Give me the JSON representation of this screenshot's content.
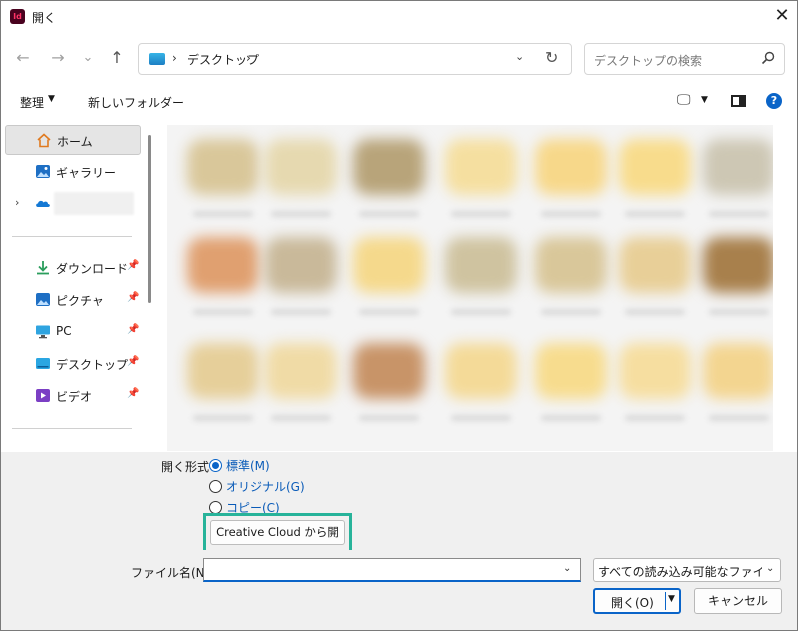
{
  "window": {
    "title": "開く",
    "app_badge": "Id"
  },
  "nav": {
    "back_icon": "←",
    "forward_icon": "→",
    "recent_icon": "⌄",
    "up_icon": "↑",
    "address_path": "デスクトップ",
    "address_sep": "›",
    "search_placeholder": "デスクトップの検索"
  },
  "toolbar": {
    "organize_label": "整理",
    "new_folder_label": "新しいフォルダー"
  },
  "sidebar": {
    "items": [
      {
        "label": "ホーム",
        "icon": "home-icon",
        "pinned": false,
        "selected": true
      },
      {
        "label": "ギャラリー",
        "icon": "gallery-icon",
        "pinned": false
      },
      {
        "label": "",
        "icon": "onedrive-icon",
        "pinned": false
      },
      {
        "label": "ダウンロード",
        "icon": "download-icon",
        "pinned": true
      },
      {
        "label": "ピクチャ",
        "icon": "pictures-icon",
        "pinned": true
      },
      {
        "label": "PC",
        "icon": "pc-icon",
        "pinned": true
      },
      {
        "label": "デスクトップ",
        "icon": "desktop-icon",
        "pinned": true
      },
      {
        "label": "ビデオ",
        "icon": "video-icon",
        "pinned": true
      }
    ]
  },
  "options": {
    "open_format_label": "開く形式",
    "radios": [
      {
        "label": "標準(M)",
        "checked": true
      },
      {
        "label": "オリジナル(G)",
        "checked": false
      },
      {
        "label": "コピー(C)",
        "checked": false
      }
    ],
    "cc_button_label": "Creative Cloud から開く"
  },
  "footer": {
    "filename_label": "ファイル名(N):",
    "filename_value": "",
    "filetype_value": "すべての読み込み可能なファイル (*",
    "open_label": "開く(O)",
    "cancel_label": "キャンセル"
  },
  "colors": {
    "accent": "#0a64c8",
    "highlight": "#27b39a"
  }
}
